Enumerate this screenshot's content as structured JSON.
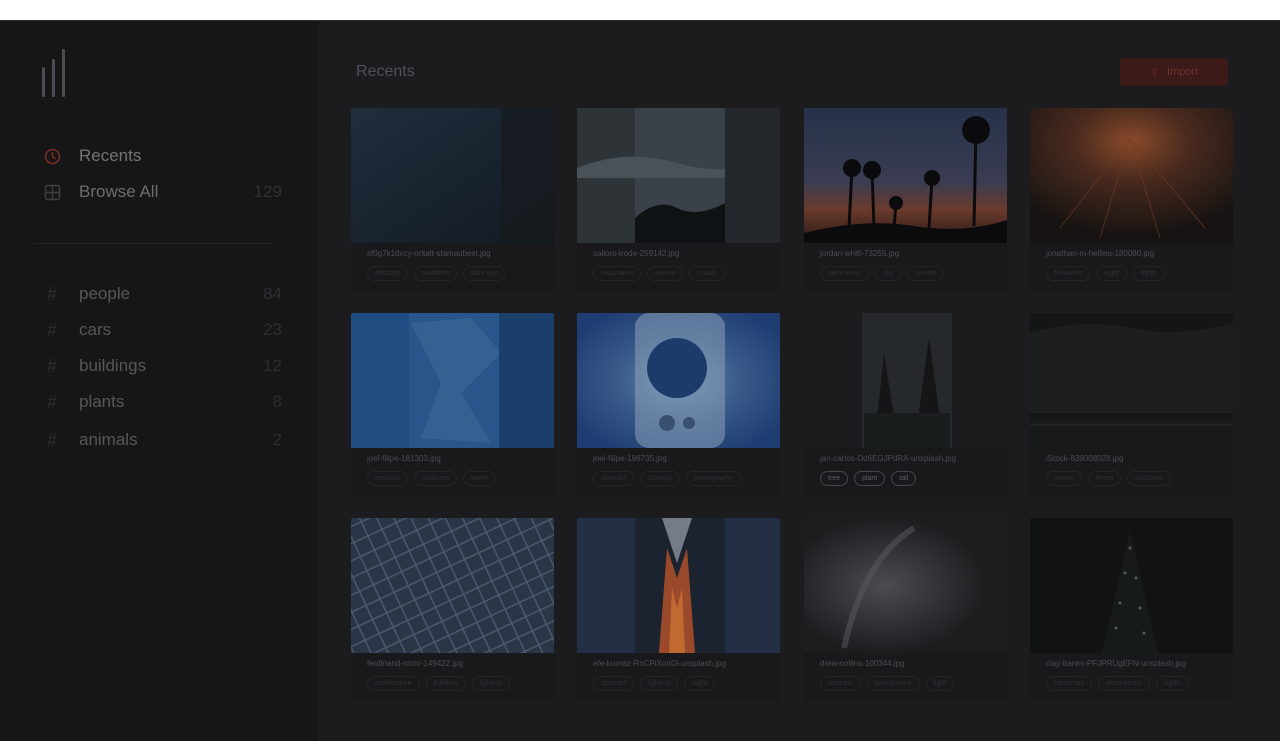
{
  "sidebar": {
    "nav": [
      {
        "label": "Recents",
        "icon": "clock-icon",
        "count": ""
      },
      {
        "label": "Browse All",
        "icon": "grid-icon",
        "count": "129"
      }
    ],
    "tags": [
      {
        "label": "people",
        "count": "84"
      },
      {
        "label": "cars",
        "count": "23"
      },
      {
        "label": "buildings",
        "count": "12"
      },
      {
        "label": "plants",
        "count": "8"
      },
      {
        "label": "animals",
        "count": "2"
      }
    ]
  },
  "main": {
    "title": "Recents",
    "import_label": "Import",
    "import_icon": "upload-icon",
    "cards": [
      {
        "filename": "sf0g7k1dxcy-oritalt-stamaubest.jpg",
        "tags": [
          "abstract",
          "outdoors",
          "blue sky"
        ]
      },
      {
        "filename": "sailors-trode-259142.jpg",
        "tags": [
          "mountains",
          "nature",
          "clouds"
        ]
      },
      {
        "filename": "jordan-whitt-73255.jpg",
        "tags": [
          "palm trees",
          "sky",
          "sunset"
        ]
      },
      {
        "filename": "jonathan-m-hellieu-180080.jpg",
        "tags": [
          "fireworks",
          "night",
          "lights"
        ]
      },
      {
        "filename": "joel-filipe-181303.jpg",
        "tags": [
          "abstract",
          "outdoors",
          "water"
        ]
      },
      {
        "filename": "joel-filipe-196735.jpg",
        "tags": [
          "abstract",
          "closeup",
          "photography"
        ]
      },
      {
        "filename": "jan-carlos-Dd6EGJPdRA-unsplash.jpg",
        "tags": [
          "tree",
          "plant",
          "tall"
        ]
      },
      {
        "filename": "iStock-839008028.jpg",
        "tags": [
          "nature",
          "forest",
          "outdoors"
        ]
      },
      {
        "filename": "ferdinand-stohr-149422.jpg",
        "tags": [
          "architecture",
          "building",
          "lighting"
        ]
      },
      {
        "filename": "efe-kurnaz-RnCPiXonDl-unsplash.jpg",
        "tags": [
          "abstract",
          "lighting",
          "night"
        ]
      },
      {
        "filename": "drew-collins-100344.jpg",
        "tags": [
          "abstract",
          "background",
          "light"
        ]
      },
      {
        "filename": "clay-banks-PFJPRUgEFN-unsplash.jpg",
        "tags": [
          "christmas",
          "decorations",
          "lights"
        ]
      }
    ]
  }
}
